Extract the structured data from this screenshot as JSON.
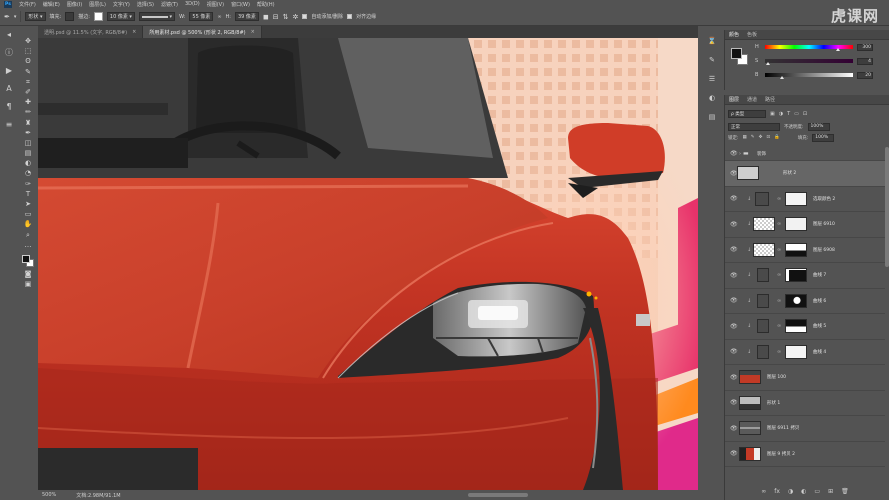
{
  "watermark": "虎课网",
  "menubar": {
    "items": [
      "文件(F)",
      "编辑(E)",
      "图像(I)",
      "图层(L)",
      "文字(Y)",
      "选择(S)",
      "滤镜(T)",
      "3D(D)",
      "视图(V)",
      "窗口(W)",
      "帮助(H)"
    ]
  },
  "options": {
    "mode": "形状",
    "fill_label": "填充:",
    "stroke_label": "描边:",
    "stroke_size": "10 像素",
    "w_label": "W:",
    "w_value": "55 像素",
    "h_label": "H:",
    "h_value": "39 像素",
    "auto_add_delete": "自动添加/删除",
    "align_edges": "对齐边缘",
    "fill_color": "#3a3a3a",
    "stroke_color": "#ffffff"
  },
  "tabs": [
    {
      "label": "透明.psd @ 11.5% (文字, RGB/8#)",
      "close": "×"
    },
    {
      "label": "所用素材.psd @ 500% (形状 2, RGB/8#)",
      "close": "×"
    }
  ],
  "toolbar": {
    "tools": [
      "move-icon",
      "marquee-icon",
      "lasso-icon",
      "quick-select-icon",
      "crop-icon",
      "eyedropper-icon",
      "healing-icon",
      "brush-icon",
      "stamp-icon",
      "history-brush-icon",
      "eraser-icon",
      "gradient-icon",
      "blur-icon",
      "dodge-icon",
      "pen-icon",
      "type-icon",
      "path-select-icon",
      "shape-icon",
      "hand-icon",
      "zoom-icon",
      "more-icon"
    ],
    "glyphs": [
      "✥",
      "⬚",
      "ʘ",
      "✎",
      "⌗",
      "✐",
      "✚",
      "✏",
      "♜",
      "✒",
      "◫",
      "▤",
      "◐",
      "◔",
      "✑",
      "T",
      "➤",
      "▭",
      "✋",
      "⌕",
      "…"
    ]
  },
  "status": {
    "zoom": "500%",
    "doc": "文档:2.98M/91.1M"
  },
  "color_panel": {
    "tabs": [
      "颜色",
      "色板"
    ],
    "sliders": [
      {
        "label": "H",
        "value": "300",
        "pos": 0.83
      },
      {
        "label": "S",
        "value": "4",
        "pos": 0.04
      },
      {
        "label": "B",
        "value": "20",
        "pos": 0.2
      }
    ]
  },
  "layers_panel": {
    "tabs": [
      "图层",
      "通道",
      "路径"
    ],
    "filter_label": "ρ 类型",
    "blend_mode": "正常",
    "opacity_label": "不透明度:",
    "opacity_value": "100%",
    "lock_label": "锁定:",
    "fill_label": "填充:",
    "fill_value": "100%",
    "layers": [
      {
        "name": "装饰",
        "type": "group"
      },
      {
        "name": "形状 2",
        "type": "shape",
        "selected": true
      },
      {
        "name": "选取颜色 2",
        "type": "adjustment"
      },
      {
        "name": "图层 6910",
        "type": "layer-mask"
      },
      {
        "name": "图层 6908",
        "type": "layer-mask"
      },
      {
        "name": "曲线 7",
        "type": "curves"
      },
      {
        "name": "曲线 6",
        "type": "curves"
      },
      {
        "name": "曲线 5",
        "type": "curves"
      },
      {
        "name": "曲线 4",
        "type": "curves"
      },
      {
        "name": "图层 100",
        "type": "image"
      },
      {
        "name": "形状 1",
        "type": "shape"
      },
      {
        "name": "图层 6911 拷贝",
        "type": "image"
      },
      {
        "name": "图层 9 拷贝 2",
        "type": "image"
      }
    ],
    "footer_icons": [
      "∞",
      "fx",
      "◑",
      "◐",
      "▭",
      "⊞",
      "🗑"
    ]
  }
}
